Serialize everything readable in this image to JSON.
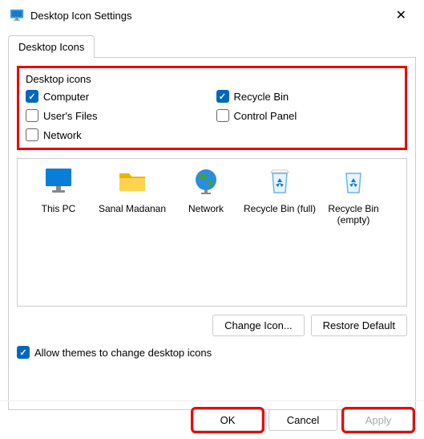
{
  "titlebar": {
    "title": "Desktop Icon Settings"
  },
  "tabs": {
    "active": "Desktop Icons"
  },
  "group": {
    "label": "Desktop icons",
    "items": [
      {
        "label": "Computer",
        "checked": true
      },
      {
        "label": "Recycle Bin",
        "checked": true
      },
      {
        "label": "User's Files",
        "checked": false
      },
      {
        "label": "Control Panel",
        "checked": false
      },
      {
        "label": "Network",
        "checked": false
      }
    ]
  },
  "preview": {
    "items": [
      {
        "label": "This PC",
        "icon": "monitor"
      },
      {
        "label": "Sanal Madanan",
        "icon": "folder"
      },
      {
        "label": "Network",
        "icon": "globe"
      },
      {
        "label": "Recycle Bin (full)",
        "icon": "bin"
      },
      {
        "label": "Recycle Bin (empty)",
        "icon": "bin"
      }
    ]
  },
  "buttons": {
    "change_icon": "Change Icon...",
    "restore_default": "Restore Default"
  },
  "allow_themes": {
    "label": "Allow themes to change desktop icons",
    "checked": true
  },
  "footer": {
    "ok": "OK",
    "cancel": "Cancel",
    "apply": "Apply"
  }
}
